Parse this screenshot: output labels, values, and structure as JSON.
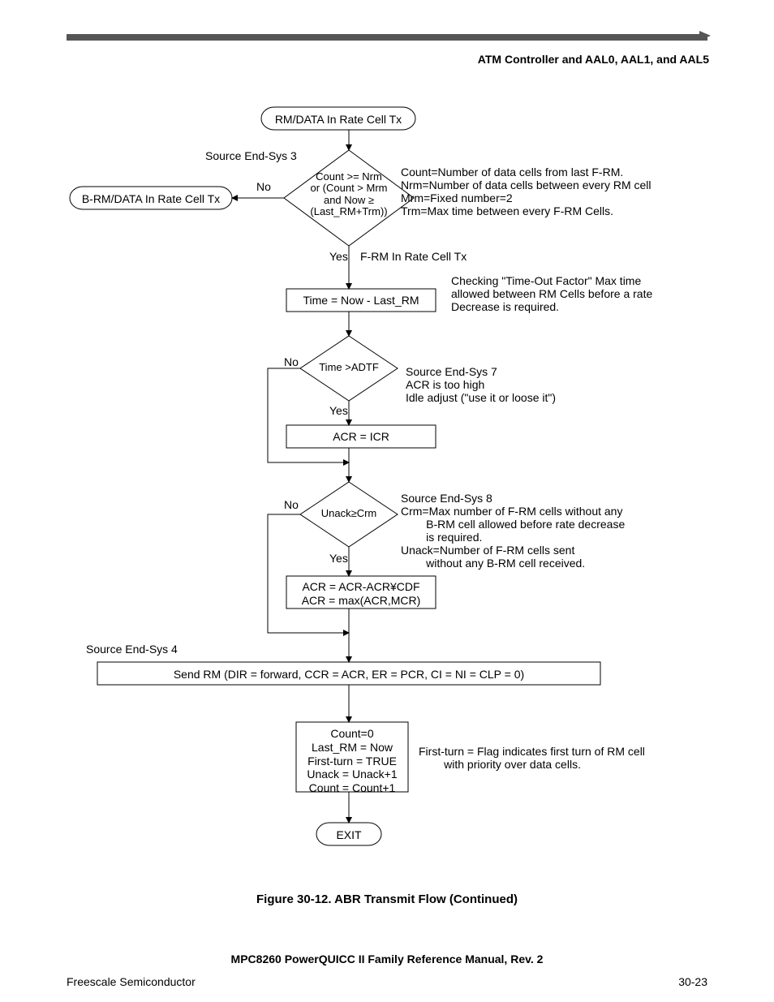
{
  "header": {
    "title": "ATM Controller and AAL0, AAL1, and AAL5"
  },
  "nodes": {
    "term_start": "RM/DATA In Rate Cell Tx",
    "term_brm": "B-RM/DATA In Rate Cell Tx",
    "dec1": "Count >= Nrm\nor (Count > Mrm\nand Now ≥\n(Last_RM+Trm))",
    "proc_time": "Time = Now - Last_RM",
    "dec2": "Time >ADTF",
    "proc_acr_icr": "ACR = ICR",
    "dec3": "Unack≥Crm",
    "proc_acr_cdf": "ACR = ACR-ACR¥CDF\nACR = max(ACR,MCR)",
    "proc_send": "Send RM (DIR = forward, CCR = ACR, ER = PCR, CI = NI = CLP = 0)",
    "proc_final": "Count=0\nLast_RM = Now\nFirst-turn = TRUE\nUnack = Unack+1\nCount = Count+1",
    "term_exit": "EXIT"
  },
  "labels": {
    "src3": "Source End-Sys 3",
    "src4": "Source End-Sys 4",
    "no1": "No",
    "yes1": "Yes",
    "no2": "No",
    "yes2": "Yes",
    "no3": "No",
    "yes3": "Yes",
    "frm": "F-RM In Rate Cell Tx"
  },
  "annotations": {
    "a1": "Count=Number of data cells from last F-RM.\nNrm=Number of data cells between every RM cell\nMrm=Fixed number=2\nTrm=Max time between every F-RM Cells.",
    "a2": "Checking \"Time-Out Factor\" Max time\nallowed between RM Cells before a rate\nDecrease is required.",
    "a3": "Source End-Sys 7\nACR is too high\nIdle adjust (\"use it or loose it\")",
    "a4": "Source End-Sys 8\nCrm=Max number of F-RM cells without any\n        B-RM cell allowed before rate decrease\n        is required.\nUnack=Number of F-RM cells sent\n        without any B-RM cell received.",
    "a5": "First-turn = Flag indicates first turn of RM cell\n        with priority over data cells."
  },
  "caption": "Figure 30-12. ABR Transmit Flow (Continued)",
  "manual": "MPC8260 PowerQUICC II Family Reference Manual, Rev. 2",
  "footer": {
    "left": "Freescale Semiconductor",
    "right": "30-23"
  }
}
